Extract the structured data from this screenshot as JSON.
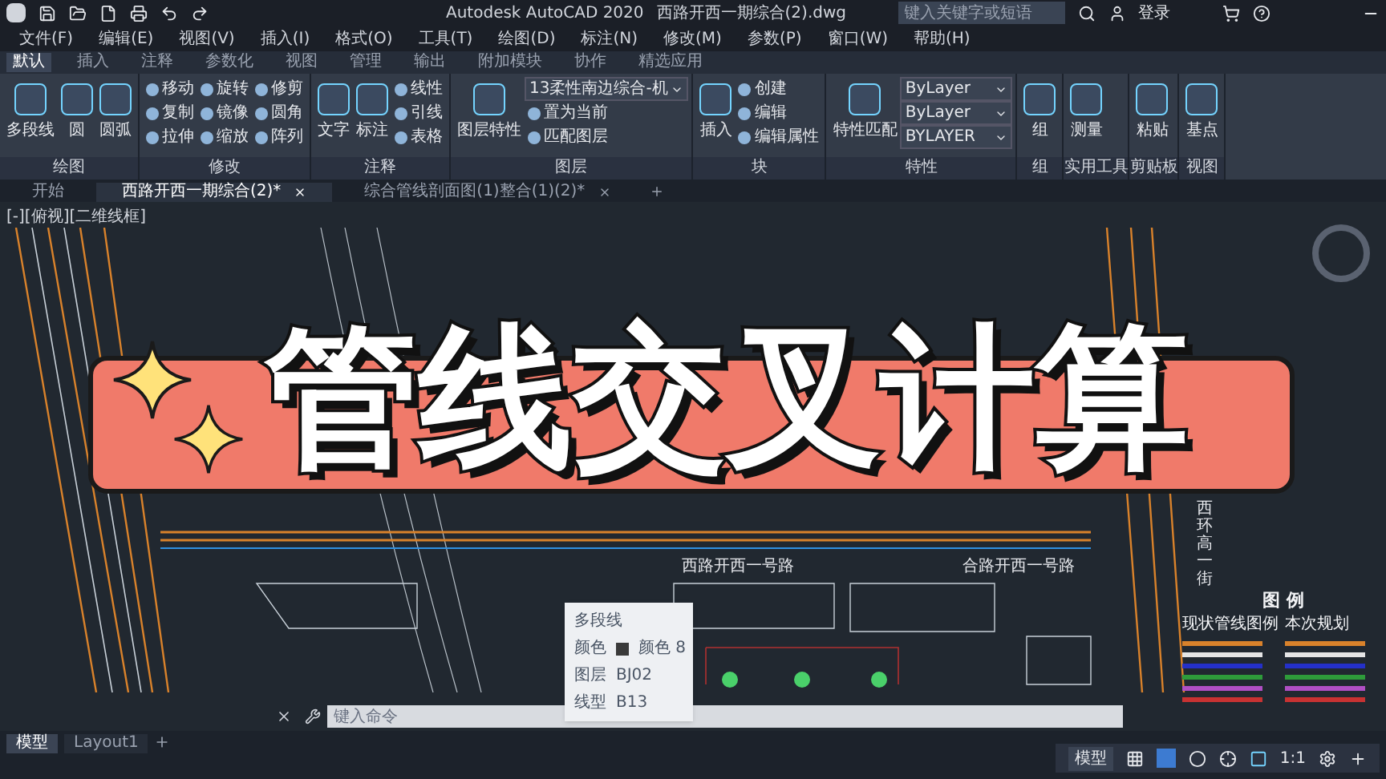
{
  "window": {
    "title": "Autodesk AutoCAD 2020",
    "file": "西路开西一期综合(2).dwg"
  },
  "search": {
    "placeholder": "键入关键字或短语"
  },
  "account": {
    "label": "登录"
  },
  "menu": [
    "文件(F)",
    "编辑(E)",
    "视图(V)",
    "插入(I)",
    "格式(O)",
    "工具(T)",
    "绘图(D)",
    "标注(N)",
    "修改(M)",
    "参数(P)",
    "窗口(W)",
    "帮助(H)"
  ],
  "ribbon_tabs": [
    {
      "label": "默认",
      "selected": true
    },
    {
      "label": "插入",
      "selected": false
    },
    {
      "label": "注释",
      "selected": false
    },
    {
      "label": "参数化",
      "selected": false
    },
    {
      "label": "视图",
      "selected": false
    },
    {
      "label": "管理",
      "selected": false
    },
    {
      "label": "输出",
      "selected": false
    },
    {
      "label": "附加模块",
      "selected": false
    },
    {
      "label": "协作",
      "selected": false
    },
    {
      "label": "精选应用",
      "selected": false
    }
  ],
  "panels": [
    {
      "title": "绘图",
      "items": [
        {
          "kind": "large",
          "label": "多段线"
        },
        {
          "kind": "large",
          "label": "圆"
        },
        {
          "kind": "large",
          "label": "圆弧"
        }
      ]
    },
    {
      "title": "修改",
      "items": [
        {
          "kind": "small",
          "label": "移动"
        },
        {
          "kind": "small",
          "label": "复制"
        },
        {
          "kind": "small",
          "label": "拉伸"
        },
        {
          "kind": "small",
          "label": "旋转"
        },
        {
          "kind": "small",
          "label": "镜像"
        },
        {
          "kind": "small",
          "label": "缩放"
        },
        {
          "kind": "small",
          "label": "修剪"
        },
        {
          "kind": "small",
          "label": "圆角"
        },
        {
          "kind": "small",
          "label": "阵列"
        }
      ]
    },
    {
      "title": "注释",
      "items": [
        {
          "kind": "large",
          "label": "文字"
        },
        {
          "kind": "large",
          "label": "标注"
        },
        {
          "kind": "small",
          "label": "线性"
        },
        {
          "kind": "small",
          "label": "引线"
        },
        {
          "kind": "small",
          "label": "表格"
        }
      ]
    },
    {
      "title": "图层",
      "items": [
        {
          "kind": "large",
          "label": "图层特性"
        },
        {
          "kind": "dropdown",
          "label": "13柔性南边综合-机"
        },
        {
          "kind": "small",
          "label": "置为当前"
        },
        {
          "kind": "small",
          "label": "匹配图层"
        }
      ]
    },
    {
      "title": "块",
      "items": [
        {
          "kind": "large",
          "label": "插入"
        },
        {
          "kind": "small",
          "label": "创建"
        },
        {
          "kind": "small",
          "label": "编辑"
        },
        {
          "kind": "small",
          "label": "编辑属性"
        }
      ]
    },
    {
      "title": "特性",
      "items": [
        {
          "kind": "large",
          "label": "特性匹配"
        },
        {
          "kind": "dropdown",
          "label": "ByLayer"
        },
        {
          "kind": "dropdown",
          "label": "ByLayer"
        },
        {
          "kind": "dropdown",
          "label": "BYLAYER"
        }
      ]
    },
    {
      "title": "组",
      "items": [
        {
          "kind": "large",
          "label": "组"
        }
      ]
    },
    {
      "title": "实用工具",
      "items": [
        {
          "kind": "large",
          "label": "测量"
        }
      ]
    },
    {
      "title": "剪贴板",
      "items": [
        {
          "kind": "large",
          "label": "粘贴"
        }
      ]
    },
    {
      "title": "视图",
      "items": [
        {
          "kind": "large",
          "label": "基点"
        }
      ]
    }
  ],
  "doc_tabs": [
    {
      "label": "开始",
      "selected": false
    },
    {
      "label": "西路开西一期综合(2)*",
      "selected": true
    },
    {
      "label": "综合管线剖面图(1)整合(1)(2)*",
      "selected": false
    }
  ],
  "viewport": {
    "label": "[-][俯视][二维线框]"
  },
  "canvas_labels": [
    "西路开西一号路",
    "合路开西一号路"
  ],
  "vertical_label": "西环高一街",
  "legend": {
    "title": "图 例",
    "columns": [
      "现状管线图例",
      "本次规划"
    ],
    "lines": [
      {
        "color": "#d9822b"
      },
      {
        "color": "#e5e5e5"
      },
      {
        "color": "#2430c8"
      },
      {
        "color": "#2e9b3a"
      },
      {
        "color": "#b04fc4"
      },
      {
        "color": "#c83232"
      }
    ]
  },
  "banner": {
    "title": "管线交叉计算"
  },
  "tooltip": {
    "title": "多段线",
    "rows": [
      {
        "name": "颜色",
        "value": "颜色 8",
        "color": "#3a3a3a"
      },
      {
        "name": "图层",
        "value": "BJ02"
      },
      {
        "name": "线型",
        "value": "B13"
      }
    ]
  },
  "command": {
    "placeholder": "键入命令"
  },
  "layout_tabs": [
    {
      "label": "模型",
      "selected": true
    },
    {
      "label": "Layout1",
      "selected": false
    }
  ],
  "status": {
    "model": "模型",
    "scale": "1:1"
  }
}
